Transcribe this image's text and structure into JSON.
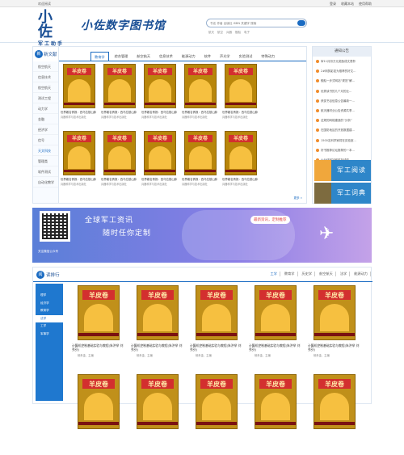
{
  "topbar": {
    "welcome": "欢迎阅读",
    "links": [
      "登录",
      "收藏本站",
      "使用帮助"
    ]
  },
  "header": {
    "logo_big": "小佐",
    "logo_small": "军工助手",
    "site_title": "小佐数字图书馆",
    "search_placeholder": "书名 作者 出版社 ISBN 关键字 搜索",
    "hotwords": [
      "航天",
      "航空",
      "兵器",
      "舰船",
      "电子"
    ]
  },
  "section1": {
    "header_label": "新文献",
    "side_items": [
      "航空航天",
      "信息技术",
      "航空航天",
      "测试工程",
      "动力学",
      "金融",
      "经济学",
      "信号",
      "天文科技",
      "管理类",
      "软件测试",
      "自动化教学"
    ],
    "active_side_index": 8,
    "tabs": [
      "教育学",
      "综合管理",
      "航空航天",
      "信息技术",
      "能源动力",
      "软件",
      "声光学",
      "实验测试",
      "特殊动力"
    ],
    "active_tab_index": 0,
    "books": [
      {
        "title": "世界著名情报：西乌拉基山脉",
        "sub": "兵器科学与技术出版社"
      },
      {
        "title": "世界著名情报：西乌拉基山脉",
        "sub": "兵器科学与技术出版社"
      },
      {
        "title": "世界著名情报：西乌拉基山脉",
        "sub": "兵器科学与技术出版社"
      },
      {
        "title": "世界著名情报：西乌拉基山脉",
        "sub": "兵器科学与技术出版社"
      },
      {
        "title": "世界著名情报：西乌拉基山脉",
        "sub": "兵器科学与技术出版社"
      },
      {
        "title": "世界著名情报：西乌拉基山脉",
        "sub": "兵器科学与技术出版社"
      },
      {
        "title": "世界著名情报：西乌拉基山脉",
        "sub": "兵器科学与技术出版社"
      },
      {
        "title": "世界著名情报：西乌拉基山脉",
        "sub": "兵器科学与技术出版社"
      },
      {
        "title": "世界著名情报：西乌拉基山脉",
        "sub": "兵器科学与技术出版社"
      },
      {
        "title": "世界著名情报：西乌拉基山脉",
        "sub": "兵器科学与技术出版社"
      }
    ],
    "cover_text": "羊皮卷",
    "more": "更多 »"
  },
  "rightcol": {
    "title": "通知公告",
    "items": [
      "军11月份万元奖励成文表彰",
      "2#网剪影如为推荐的好文...",
      "舰船一步式网站“规范”解...",
      "优秀读书的几个月的业...",
      "获奖书目信息公告最新一...",
      "航天器材业公告资源共享...",
      "这规的网络建造的“分析”",
      "在国防地区的开放数据建...",
      "1500名科学家将在实验室...",
      "好书推荐论坛推荐的一本...",
      "小分体网站即时在线的..."
    ],
    "banner_a": "军工阅读",
    "banner_b": "军工词典"
  },
  "bigbanner": {
    "line1": "全球军工资讯",
    "line2": "随时任你定制",
    "qr_label": "关注微信公众号",
    "tag": "最新资讯，定制推荐"
  },
  "section2": {
    "header_label": "读排行",
    "tabs": [
      "工学",
      "教育学",
      "历史学",
      "航空航天",
      "法学",
      "能源动力"
    ],
    "active_tab_index": 0,
    "side_items": [
      "理学",
      "经济学",
      "教育学",
      "法学",
      "工学",
      "军事学"
    ],
    "active_side_index": 3,
    "books": [
      {
        "title": "计算机控制基础实验与教程(朱洪举 刘秀芬)",
        "meta": "杨贵金，主编"
      },
      {
        "title": "计算机控制基础实验与教程(朱洪举 刘秀芬)",
        "meta": "杨贵金，主编"
      },
      {
        "title": "计算机控制基础实验与教程(朱洪举 刘秀芬)",
        "meta": "杨贵金，主编"
      },
      {
        "title": "计算机控制基础实验与教程(朱洪举 刘秀芬)",
        "meta": "杨贵金，主编"
      },
      {
        "title": "计算机控制基础实验与教程(朱洪举 刘秀芬)",
        "meta": "杨贵金，主编"
      },
      {
        "title": "",
        "meta": ""
      },
      {
        "title": "",
        "meta": ""
      },
      {
        "title": "",
        "meta": ""
      },
      {
        "title": "",
        "meta": ""
      },
      {
        "title": "",
        "meta": ""
      }
    ],
    "cover_text": "羊皮卷"
  }
}
